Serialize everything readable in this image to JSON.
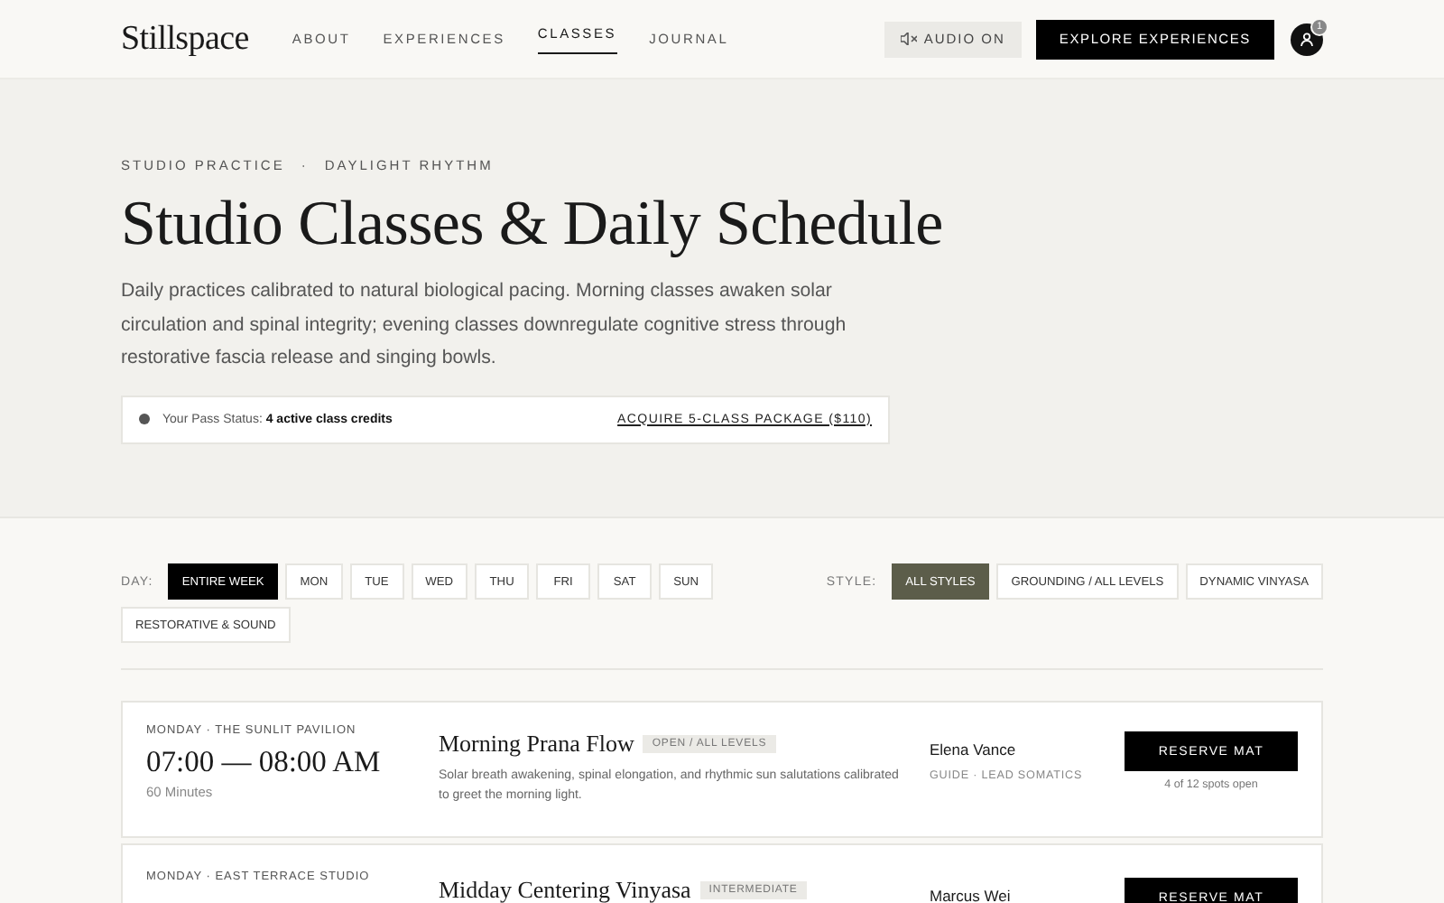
{
  "header": {
    "logo": "Stillspace",
    "nav": [
      {
        "label": "ABOUT",
        "selected": false
      },
      {
        "label": "EXPERIENCES",
        "selected": false
      },
      {
        "label": "CLASSES",
        "selected": true
      },
      {
        "label": "JOURNAL",
        "selected": false
      }
    ],
    "audio_button": "AUDIO ON",
    "cta": "EXPLORE EXPERIENCES",
    "avatar_badge": "1"
  },
  "hero": {
    "breadcrumb": [
      "STUDIO PRACTICE",
      "·",
      "DAYLIGHT RHYTHM"
    ],
    "title": "Studio Classes & Daily Schedule",
    "intro": "Daily practices calibrated to natural biological pacing. Morning classes awaken solar circulation and spinal integrity; evening classes downregulate cognitive stress through restorative fascia release and singing bowls.",
    "pass_status": "Your Pass Status: **4 active class credits**",
    "pass_link": "ACQUIRE 5-CLASS PACKAGE ($110)"
  },
  "filters": {
    "day_label": "DAY:",
    "days": [
      {
        "label": "ENTIRE WEEK",
        "selected": true
      },
      {
        "label": "MON",
        "selected": false
      },
      {
        "label": "TUE",
        "selected": false
      },
      {
        "label": "WED",
        "selected": false
      },
      {
        "label": "THU",
        "selected": false
      },
      {
        "label": "FRI",
        "selected": false
      },
      {
        "label": "SAT",
        "selected": false
      },
      {
        "label": "SUN",
        "selected": false
      }
    ],
    "style_label": "STYLE:",
    "styles": [
      {
        "label": "ALL STYLES",
        "selected": true
      },
      {
        "label": "GROUNDING / ALL LEVELS",
        "selected": false
      },
      {
        "label": "DYNAMIC VINYASA",
        "selected": false
      },
      {
        "label": "RESTORATIVE & SOUND",
        "selected": false
      }
    ]
  },
  "classes": [
    {
      "location": "MONDAY · THE SUNLIT PAVILION",
      "time": "07:00 — 08:00 AM",
      "duration": "60 Minutes",
      "title": "Morning Prana Flow",
      "level": "OPEN / ALL LEVELS",
      "description": "Solar breath awakening, spinal elongation, and rhythmic sun salutations calibrated to greet the morning light.",
      "guide": "Elena Vance",
      "guide_role": "GUIDE · LEAD SOMATICS",
      "button": "RESERVE MAT",
      "spots": "4 of 12 spots open"
    },
    {
      "location": "MONDAY · EAST TERRACE STUDIO",
      "title": "Midday Centering Vinyasa",
      "level": "INTERMEDIATE",
      "guide": "Marcus Wei",
      "button": "RESERVE MAT"
    }
  ]
}
